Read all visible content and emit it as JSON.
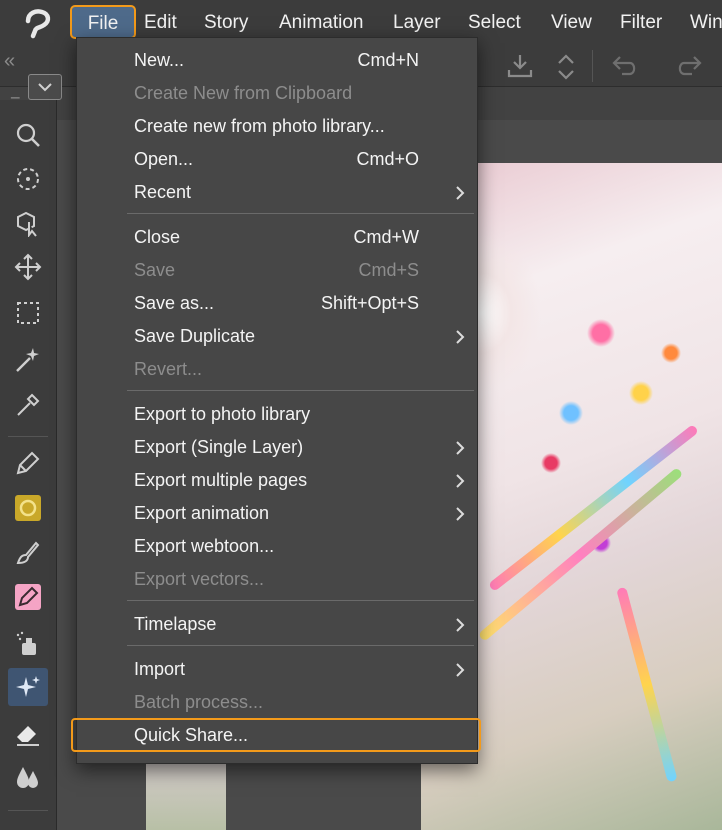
{
  "menubar": {
    "items": [
      "File",
      "Edit",
      "Story",
      "Animation",
      "Layer",
      "Select",
      "View",
      "Filter",
      "Win"
    ]
  },
  "file_menu": {
    "items": [
      {
        "label": "New...",
        "shortcut": "Cmd+N",
        "enabled": true,
        "submenu": false
      },
      {
        "label": "Create New from Clipboard",
        "shortcut": "",
        "enabled": false,
        "submenu": false
      },
      {
        "label": "Create new from photo library...",
        "shortcut": "",
        "enabled": true,
        "submenu": false
      },
      {
        "label": "Open...",
        "shortcut": "Cmd+O",
        "enabled": true,
        "submenu": false
      },
      {
        "label": "Recent",
        "shortcut": "",
        "enabled": true,
        "submenu": true
      },
      {
        "label": "Close",
        "shortcut": "Cmd+W",
        "enabled": true,
        "submenu": false
      },
      {
        "label": "Save",
        "shortcut": "Cmd+S",
        "enabled": false,
        "submenu": false
      },
      {
        "label": "Save as...",
        "shortcut": "Shift+Opt+S",
        "enabled": true,
        "submenu": false
      },
      {
        "label": "Save Duplicate",
        "shortcut": "",
        "enabled": true,
        "submenu": true
      },
      {
        "label": "Revert...",
        "shortcut": "",
        "enabled": false,
        "submenu": false
      },
      {
        "label": "Export to photo library",
        "shortcut": "",
        "enabled": true,
        "submenu": false
      },
      {
        "label": "Export (Single Layer)",
        "shortcut": "",
        "enabled": true,
        "submenu": true
      },
      {
        "label": "Export multiple pages",
        "shortcut": "",
        "enabled": true,
        "submenu": true
      },
      {
        "label": "Export animation",
        "shortcut": "",
        "enabled": true,
        "submenu": true
      },
      {
        "label": "Export webtoon...",
        "shortcut": "",
        "enabled": true,
        "submenu": false
      },
      {
        "label": "Export vectors...",
        "shortcut": "",
        "enabled": false,
        "submenu": false
      },
      {
        "label": "Timelapse",
        "shortcut": "",
        "enabled": true,
        "submenu": true
      },
      {
        "label": "Import",
        "shortcut": "",
        "enabled": true,
        "submenu": true
      },
      {
        "label": "Batch process...",
        "shortcut": "",
        "enabled": false,
        "submenu": false
      },
      {
        "label": "Quick Share...",
        "shortcut": "",
        "enabled": true,
        "submenu": false
      }
    ]
  },
  "highlight_color": "#f39a1a",
  "icons": {
    "logo": "clip-studio-logo-icon",
    "collapse": "double-chevron-left-icon",
    "toolbar": [
      "download-icon",
      "up-down-arrows-icon",
      "undo-icon",
      "redo-icon"
    ],
    "tools": [
      "zoom-icon",
      "rotate-icon",
      "object-select-icon",
      "move-icon",
      "selection-rect-icon",
      "auto-select-wand-icon",
      "eyedropper-icon",
      "pen-icon",
      "pencil-yellow-icon",
      "brush-icon",
      "marker-pink-icon",
      "airbrush-icon",
      "decoration-sparkle-icon",
      "eraser-icon",
      "blend-icon"
    ]
  }
}
